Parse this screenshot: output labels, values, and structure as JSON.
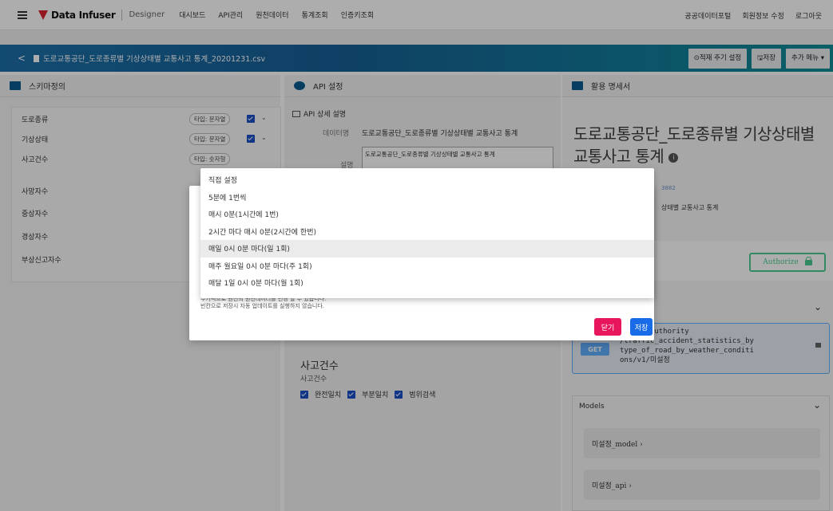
{
  "topnav": {
    "logo_text": "Data Infuser",
    "logo_sub": "Designer",
    "items": [
      "대시보드",
      "API관리",
      "원천데이터",
      "통계조회",
      "인증키조회"
    ],
    "right_items": [
      "공공데이터포털",
      "회원정보 수정",
      "로그아웃"
    ]
  },
  "header": {
    "back": "<",
    "file_title": "도로교통공단_도로종류별 기상상태별 교통사고 통계_20201231.csv",
    "buttons": [
      "⊙적재 주기 설정",
      "🖫저장",
      "추가 메뉴 ▾"
    ]
  },
  "panels": {
    "left_title": "스키마정의",
    "mid_title": "API 설정",
    "right_title": "활용 명세서"
  },
  "schema": {
    "rows": [
      {
        "name": "도로종류",
        "type": "타입: 문자열"
      },
      {
        "name": "기상상태",
        "type": "타입: 문자열"
      },
      {
        "name": "사고건수",
        "type": "타입: 숫자형"
      },
      {
        "name": "사망자수",
        "type": ""
      },
      {
        "name": "중상자수",
        "type": ""
      },
      {
        "name": "경상자수",
        "type": ""
      },
      {
        "name": "부상신고자수",
        "type": ""
      }
    ]
  },
  "api_detail": {
    "section_title": "API 상세 설명",
    "dataname_label": "데이터명",
    "dataname_value": "도로교통공단_도로종류별 기상상태별 교통사고 통계",
    "desc_label": "설명",
    "desc_value": "도로교통공단_도로종류별 기상상태별 교통사고 통계",
    "field_title": "사고건수",
    "field_sub": "사고건수",
    "checks": [
      "완전일치",
      "부분일치",
      "범위검색"
    ]
  },
  "spec": {
    "title": "도로교통공단_도로종류별 기상상태별 교통사고 통계",
    "info": "i",
    "id_fragment": "3882",
    "subtitle_fragment": "상태별 교통사고 통계",
    "authorize": "Authorize",
    "get_method": "GET",
    "get_path_lines": [
      "raffic_authority",
      "/traffic_accident_statistics_by",
      "type_of_road_by_weather_conditi",
      "ons/v1/미설정"
    ],
    "models_title": "Models",
    "models": [
      "미설정_model  ›",
      "미설정_api  ›"
    ]
  },
  "modal": {
    "note_line1": "주기적으로 원천의 원천데이터를 변경 할 수 있습니다.",
    "note_line2": "빈칸으로 저장시 자동 업데이트를 실행하지 않습니다.",
    "close": "닫기",
    "save": "저장"
  },
  "dropdown": {
    "options": [
      "직접 설정",
      "5분에 1번씩",
      "매시 0분(1시간에 1번)",
      "2시간 마다 매시 0분(2시간에 한번)",
      "매일 0시 0분 마다(일 1회)",
      "매주 월요일 0시 0분 마다(주 1회)",
      "매달 1일 0시 0분 마다(월 1회)"
    ],
    "highlighted_index": 4
  },
  "colors": {
    "brand_red": "#d9232e",
    "header_blue": "#1b6fa8",
    "checkbox_blue": "#1a4fc7",
    "authorize_green": "#49cc90",
    "get_blue": "#61affe",
    "close_pink": "#e8175d",
    "save_blue": "#1a6be8"
  }
}
